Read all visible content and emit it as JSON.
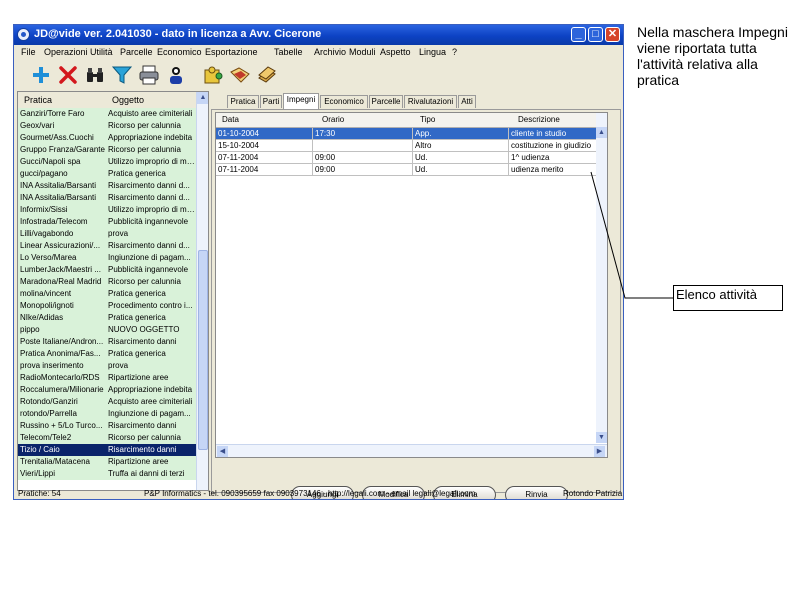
{
  "window": {
    "title": "JD@vide ver. 2.041030 - dato in licenza a Avv. Cicerone",
    "minimize": "_",
    "maximize": "□",
    "close": "✕"
  },
  "menu": [
    "File",
    "Operazioni",
    "Utilità",
    "Parcelle",
    "Economico",
    "Esportazione",
    "Tabelle",
    "Archivio",
    "Moduli",
    "Aspetto",
    "Lingua",
    "?"
  ],
  "toolbar": {
    "icons": [
      "plus-icon",
      "delete-icon",
      "binoculars-icon",
      "filter-icon",
      "print-icon",
      "person-icon",
      "puzzle-icon",
      "open-folder-icon",
      "stack-icon"
    ]
  },
  "list": {
    "headers": {
      "pratica": "Pratica",
      "oggetto": "Oggetto"
    },
    "rows": [
      {
        "pratica": "Ganziri/Torre Faro",
        "oggetto": "Acquisto aree cimiteriali"
      },
      {
        "pratica": "Geox/vari",
        "oggetto": "Ricorso per calunnia"
      },
      {
        "pratica": "Gourmet/Ass.Cuochi",
        "oggetto": "Appropriazione indebita"
      },
      {
        "pratica": "Gruppo Franza/Garante",
        "oggetto": "Ricorso per calunnia"
      },
      {
        "pratica": "Gucci/Napoli spa",
        "oggetto": "Utilizzo improprio di mar..."
      },
      {
        "pratica": "gucci/pagano",
        "oggetto": "Pratica generica"
      },
      {
        "pratica": "INA Assitalia/Barsanti",
        "oggetto": "Risarcimento danni d..."
      },
      {
        "pratica": "INA Assitalia/Barsanti",
        "oggetto": "Risarcimento danni d..."
      },
      {
        "pratica": "Informix/Sissi",
        "oggetto": "Utilizzo improprio di mar..."
      },
      {
        "pratica": "Infostrada/Telecom",
        "oggetto": "Pubblicità ingannevole"
      },
      {
        "pratica": "Lilli/vagabondo",
        "oggetto": "prova"
      },
      {
        "pratica": "Linear Assicurazioni/...",
        "oggetto": "Risarcimento danni d..."
      },
      {
        "pratica": "Lo Verso/Marea",
        "oggetto": "Ingiunzione di pagam..."
      },
      {
        "pratica": "LumberJack/Maestri ...",
        "oggetto": "Pubblicità ingannevole"
      },
      {
        "pratica": "Maradona/Real Madrid",
        "oggetto": "Ricorso per calunnia"
      },
      {
        "pratica": "molina/vincent",
        "oggetto": "Pratica generica"
      },
      {
        "pratica": "Monopoli/ignoti",
        "oggetto": "Procedimento contro i..."
      },
      {
        "pratica": "NIke/Adidas",
        "oggetto": "Pratica generica"
      },
      {
        "pratica": "pippo",
        "oggetto": "NUOVO OGGETTO"
      },
      {
        "pratica": "Poste Italiane/Andron...",
        "oggetto": "Risarcimento danni"
      },
      {
        "pratica": "Pratica Anonima/Fas...",
        "oggetto": "Pratica generica"
      },
      {
        "pratica": "prova inserimento",
        "oggetto": "prova"
      },
      {
        "pratica": "RadioMontecarlo/RDS",
        "oggetto": "Ripartizione aree"
      },
      {
        "pratica": "Roccalumera/Milionarie",
        "oggetto": "Appropriazione indebita"
      },
      {
        "pratica": "Rotondo/Ganziri",
        "oggetto": "Acquisto aree cimiteriali"
      },
      {
        "pratica": "rotondo/Parrella",
        "oggetto": "Ingiunzione di pagam..."
      },
      {
        "pratica": "Russino + 5/Lo Turco...",
        "oggetto": "Risarcimento danni"
      },
      {
        "pratica": "Telecom/Tele2",
        "oggetto": "Ricorso per calunnia"
      },
      {
        "pratica": "Tizio / Caio",
        "oggetto": "Risarcimento danni",
        "selected": true
      },
      {
        "pratica": "Trenitalia/Matacena",
        "oggetto": "Ripartizione aree"
      },
      {
        "pratica": "Vieri/Lippi",
        "oggetto": "Truffa ai danni di terzi"
      }
    ]
  },
  "tabs": [
    {
      "label": "Pratica"
    },
    {
      "label": "Parti"
    },
    {
      "label": "Impegni",
      "active": true
    },
    {
      "label": "Economico"
    },
    {
      "label": "Parcelle"
    },
    {
      "label": "Rivalutazioni"
    },
    {
      "label": "Atti"
    }
  ],
  "impegni": {
    "headers": {
      "data": "Data",
      "orario": "Orario",
      "tipo": "Tipo",
      "descrizione": "Descrizione"
    },
    "rows": [
      {
        "data": "01-10-2004",
        "orario": "17:30",
        "tipo": "App.",
        "descrizione": "cliente in studio",
        "selected": true
      },
      {
        "data": "15-10-2004",
        "orario": "",
        "tipo": "Altro",
        "descrizione": "costituzione in giudizio"
      },
      {
        "data": "07-11-2004",
        "orario": "09:00",
        "tipo": "Ud.",
        "descrizione": "1^ udienza"
      },
      {
        "data": "07-11-2004",
        "orario": "09:00",
        "tipo": "Ud.",
        "descrizione": "udienza merito"
      }
    ]
  },
  "buttons": {
    "add": "Aggiungi",
    "edit": "Modifica",
    "delete": "Elimina",
    "send": "Rinvia"
  },
  "status": {
    "count": "Pratiche: 54",
    "info": "P&P Informatics - tel. 090395659 fax 0903973146 - http://legali.com - email legali@legali.com",
    "user": "Rotondo Patrizia"
  },
  "annotation": {
    "description": "Nella maschera Impegni viene riportata tutta l'attività relativa alla pratica",
    "callout": "Elenco attività"
  },
  "colors": {
    "list_row": "#d9f2d9",
    "selected": "#0a246a",
    "grid_selected": "#3169c6",
    "titlebar": "#0d42c4"
  }
}
